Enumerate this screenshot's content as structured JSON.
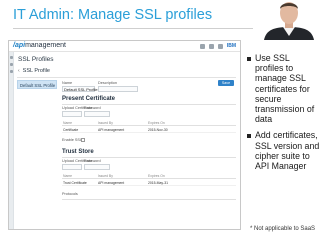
{
  "slide": {
    "title": "IT Admin: Manage SSL profiles",
    "footnote": "* Not applicable to SaaS",
    "title_color": "#2b9fd8"
  },
  "bullets": [
    "Use SSL profiles to manage SSL certificates for secure transmission of data",
    "Add certificates, SSL version and cipher suite to API Manager"
  ],
  "app": {
    "brand_prefix": "/api",
    "brand_name": "management",
    "vendor": "IBM",
    "page_title": "SSL Profiles",
    "section_title": "SSL Profile",
    "list_item": "Default SSL Profile",
    "save_label": "Save",
    "accent": "#2f82c9"
  },
  "form": {
    "name_label": "Name",
    "name_value": "Default SSL Profile",
    "description_label": "Description"
  },
  "present_certificate": {
    "heading": "Present Certificate",
    "upload_label": "Upload Certificate",
    "password_label": "Password",
    "columns": [
      "Name",
      "Issued By",
      "Expires On"
    ],
    "rows": [
      [
        "Certificate",
        "API management",
        "2015-Nov-30"
      ]
    ],
    "option_label": "Enable SSL"
  },
  "trust_store": {
    "heading": "Trust Store",
    "upload_label": "Upload Certificate",
    "password_label": "Password",
    "columns": [
      "Name",
      "Issued By",
      "Expires On"
    ],
    "rows": [
      [
        "Trust Certificate",
        "API management",
        "2015-May-31"
      ]
    ],
    "protocols_label": "Protocols"
  }
}
